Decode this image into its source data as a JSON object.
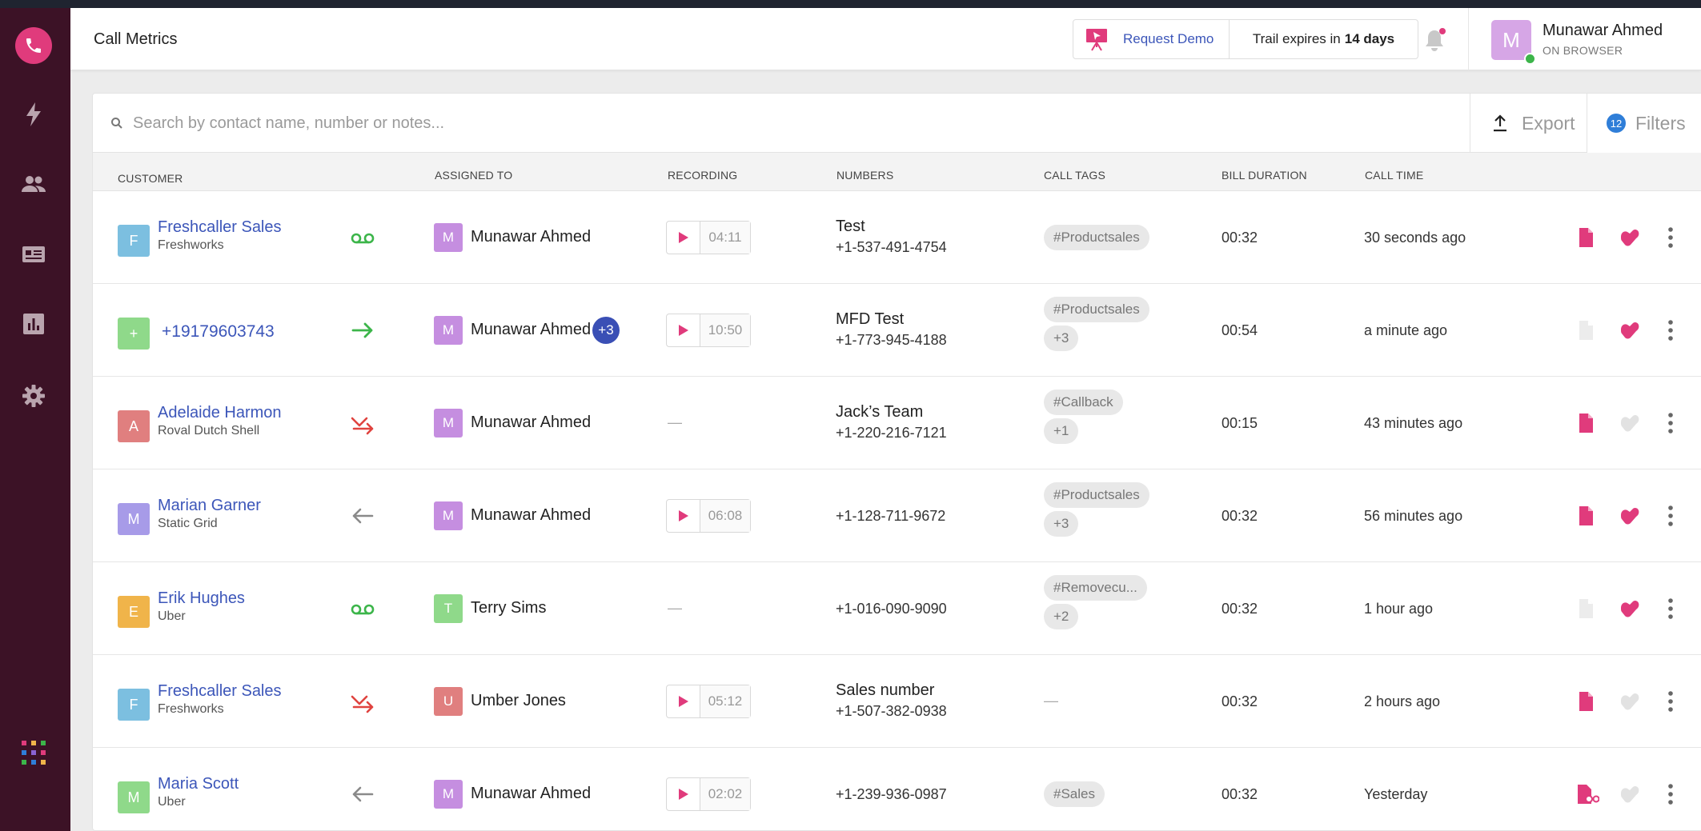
{
  "header": {
    "title": "Call Metrics",
    "request_demo": "Request Demo",
    "trial_prefix": "Trail expires in",
    "trial_days": "14 days",
    "user_name": "Munawar Ahmed",
    "user_initial": "M",
    "user_status": "ON BROWSER"
  },
  "toolbar": {
    "search_placeholder": "Search by contact name, number or notes...",
    "export_label": "Export",
    "filters_label": "Filters",
    "filters_count": "12"
  },
  "columns": {
    "customer": "CUSTOMER",
    "assigned": "ASSIGNED TO",
    "recording": "RECORDING",
    "numbers": "NUMBERS",
    "tags": "CALL TAGS",
    "bill": "BILL DURATION",
    "time": "CALL TIME"
  },
  "colors": {
    "sidebar": "#3c1226",
    "brand_pink": "#e03b7c",
    "link_blue": "#3c56b9",
    "green": "#3cb54a",
    "red": "#e0433f"
  },
  "rows": [
    {
      "initial": "F",
      "av_color": "#7cbfe0",
      "name": "Freshcaller Sales",
      "company": "Freshworks",
      "direction": "voicemail-icon",
      "agent_initial": "M",
      "agent_color": "#c58ee0",
      "agent": "Munawar Ahmed",
      "agent_more": "",
      "rec": "04:11",
      "num_label": "Test",
      "number": "+1-537-491-4754",
      "tag1": "#Productsales",
      "tag2": "",
      "bill": "00:32",
      "time": "30 seconds ago",
      "note": true,
      "hand": true
    },
    {
      "initial": "+",
      "av_color": "#8fd98a",
      "name": "+19179603743",
      "company": "",
      "direction": "outgoing-arrow-icon",
      "agent_initial": "M",
      "agent_color": "#c58ee0",
      "agent": "Munawar Ahmed",
      "agent_more": "+3",
      "rec": "10:50",
      "num_label": "MFD Test",
      "number": "+1-773-945-4188",
      "tag1": "#Productsales",
      "tag2": "+3",
      "bill": "00:54",
      "time": "a minute ago",
      "note": false,
      "hand": true
    },
    {
      "initial": "A",
      "av_color": "#e07f7f",
      "name": "Adelaide Harmon",
      "company": "Roval Dutch Shell",
      "direction": "missed-call-icon",
      "agent_initial": "M",
      "agent_color": "#c58ee0",
      "agent": "Munawar Ahmed",
      "agent_more": "",
      "rec": "",
      "num_label": "Jack’s Team",
      "number": "+1-220-216-7121",
      "tag1": "#Callback",
      "tag2": "+1",
      "bill": "00:15",
      "time": "43 minutes ago",
      "note": true,
      "hand": false
    },
    {
      "initial": "M",
      "av_color": "#a79be8",
      "name": "Marian Garner",
      "company": "Static Grid",
      "direction": "incoming-arrow-icon",
      "agent_initial": "M",
      "agent_color": "#c58ee0",
      "agent": "Munawar Ahmed",
      "agent_more": "",
      "rec": "06:08",
      "num_label": "",
      "number": "+1-128-711-9672",
      "tag1": "#Productsales",
      "tag2": "+3",
      "bill": "00:32",
      "time": "56 minutes ago",
      "note": true,
      "hand": true
    },
    {
      "initial": "E",
      "av_color": "#f0b44a",
      "name": "Erik Hughes",
      "company": "Uber",
      "direction": "voicemail-icon",
      "agent_initial": "T",
      "agent_color": "#8fd98a",
      "agent": "Terry Sims",
      "agent_more": "",
      "rec": "",
      "num_label": "",
      "number": "+1-016-090-9090",
      "tag1": "#Removecu...",
      "tag2": "+2",
      "bill": "00:32",
      "time": "1 hour ago",
      "note": false,
      "hand": true
    },
    {
      "initial": "F",
      "av_color": "#7cbfe0",
      "name": "Freshcaller Sales",
      "company": "Freshworks",
      "direction": "missed-call-icon",
      "agent_initial": "U",
      "agent_color": "#e07f7f",
      "agent": "Umber Jones",
      "agent_more": "",
      "rec": "05:12",
      "num_label": "Sales number",
      "number": "+1-507-382-0938",
      "tag1": "",
      "tag2": "",
      "bill": "00:32",
      "time": "2 hours ago",
      "note": true,
      "hand": false
    },
    {
      "initial": "M",
      "av_color": "#8fd98a",
      "name": "Maria Scott",
      "company": "Uber",
      "direction": "incoming-arrow-icon",
      "agent_initial": "M",
      "agent_color": "#c58ee0",
      "agent": "Munawar Ahmed",
      "agent_more": "",
      "rec": "02:02",
      "num_label": "",
      "number": "+1-239-936-0987",
      "tag1": "#Sales",
      "tag2": "",
      "bill": "00:32",
      "time": "Yesterday",
      "note": "voicemail",
      "hand": false
    }
  ]
}
